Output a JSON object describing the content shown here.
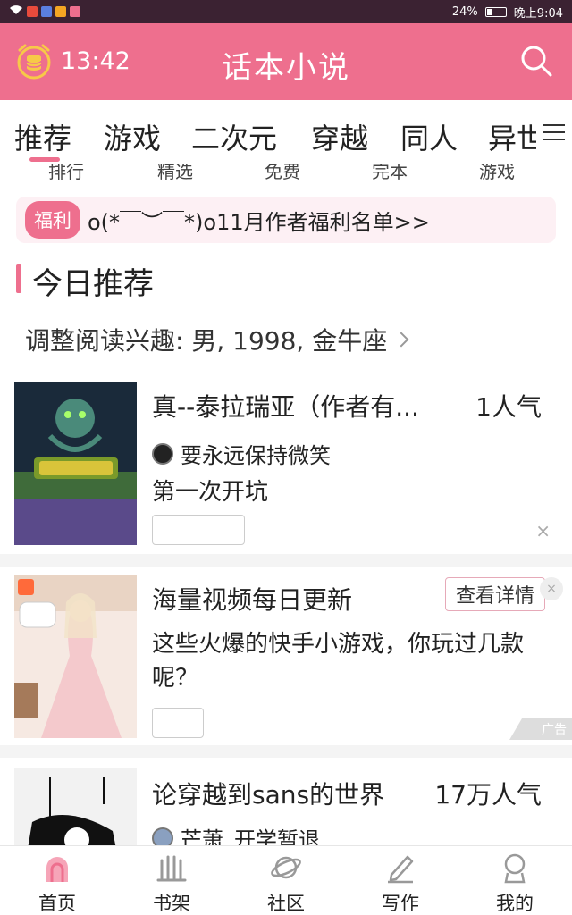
{
  "status_bar": {
    "battery": "24%",
    "time": "晚上9:04"
  },
  "header": {
    "clock": "13:42",
    "title": "话本小说"
  },
  "tabs": [
    "推荐",
    "游戏",
    "二次元",
    "穿越",
    "同人",
    "异世"
  ],
  "subnav": [
    "排行",
    "精选",
    "免费",
    "完本",
    "游戏"
  ],
  "banner": {
    "badge": "福利",
    "text": "o(*￣︶￣*)o11月作者福利名单>>"
  },
  "section": {
    "title": "今日推荐"
  },
  "interest": {
    "text": "调整阅读兴趣: 男, 1998, 金牛座"
  },
  "cards": [
    {
      "title": "真--泰拉瑞亚（作者有...",
      "popularity": "1人气",
      "author": "要永远保持微笑",
      "desc": "第一次开坑",
      "close": "×"
    },
    {
      "title": "论穿越到sans的世界",
      "popularity": "17万人气",
      "author": "芒萧_开学暂退"
    }
  ],
  "ad": {
    "title": "海量视频每日更新",
    "button": "查看详情",
    "desc": "这些火爆的快手小游戏，你玩过几款呢？",
    "label": "广告",
    "close": "×"
  },
  "bottom_nav": [
    "首页",
    "书架",
    "社区",
    "写作",
    "我的"
  ],
  "colors": {
    "accent": "#ee6f8e",
    "status_bar": "#3b2232"
  }
}
